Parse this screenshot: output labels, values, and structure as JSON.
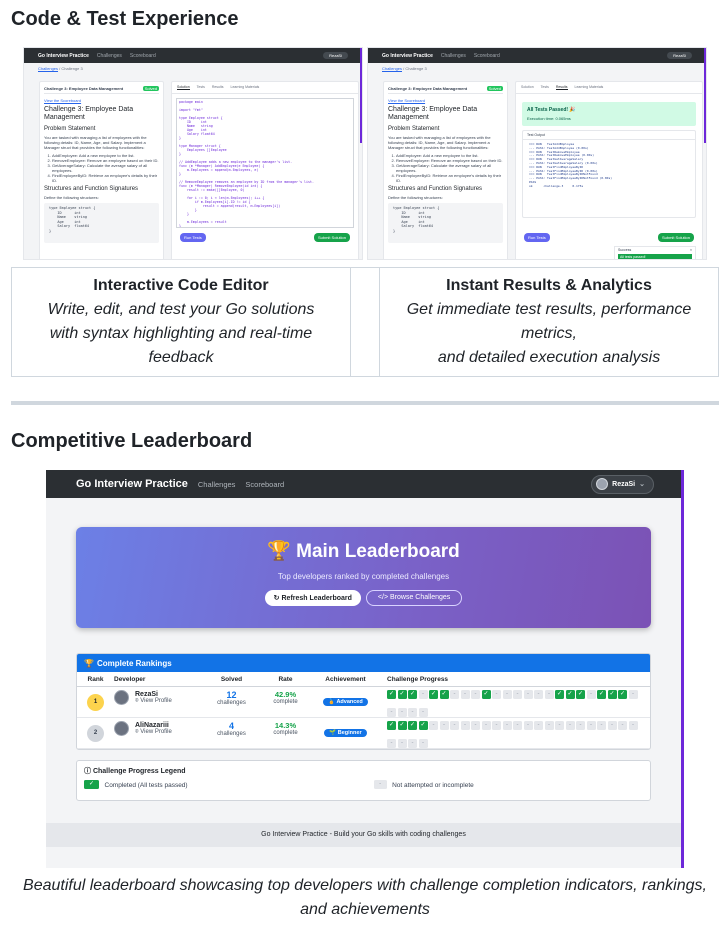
{
  "sections": {
    "code_test": "Code & Test Experience",
    "leaderboard": "Competitive Leaderboard"
  },
  "mini_app": {
    "brand": "Go Interview Practice",
    "nav_challenges": "Challenges",
    "nav_scoreboard": "Scoreboard",
    "user": "RezaSi",
    "crumb_link": "Challenges",
    "crumb_rest": " / Challenge 3",
    "panel_header": "Challenge 3: Employee Data Management",
    "panel_badge": "Solved",
    "view_scoreboard": "View the Scoreboard",
    "challenge_title": "Challenge 3: Employee Data Management",
    "problem_statement": "Problem Statement",
    "intro": "You are tasked with managing a list of employees with the following details: ID, Name, Age, and Salary. Implement a Manager struct that provides the following functionalities:",
    "funcs": [
      "AddEmployee: Add a new employee to the list.",
      "RemoveEmployee: Remove an employee based on their ID.",
      "GetAverageSalary: Calculate the average salary of all employees.",
      "FindEmployeeByID: Retrieve an employee's details by their ID."
    ],
    "structures": "Structures and Function Signatures",
    "define": "Define the following structures:",
    "code_snippet": "type Employee struct {\n    ID      int\n    Name    string\n    Age     int\n    Salary  float64\n}",
    "tabs": [
      "Solution",
      "Tests",
      "Results",
      "Learning Materials"
    ],
    "editor_code": "package main\n\nimport \"fmt\"\n\ntype Employee struct {\n    ID     int\n    Name   string\n    Age    int\n    Salary float64\n}\n\ntype Manager struct {\n    Employees []Employee\n}\n\n// AddEmployee adds a new employee to the manager's list.\nfunc (m *Manager) AddEmployee(e Employee) {\n    m.Employees = append(m.Employees, e)\n}\n\n// RemoveEmployee removes an employee by ID from the manager's list.\nfunc (m *Manager) RemoveEmployee(id int) {\n    result := make([]Employee, 0)\n\n    for i := 0; i < len(m.Employees); i++ {\n        if m.Employees[i].ID != id {\n            result = append(result, m.Employees[i])\n        }\n    }\n\n    m.Employees = result\n}",
    "run_tests": "Run Tests",
    "submit": "Submit Solution",
    "passed_title": "All Tests Passed! 🎉",
    "exec_time": "Execution time: 0.065ms",
    "test_output": "Test Output",
    "output_lines": "=== RUN   TestAddEmployee\n--- PASS: TestAddEmployee (0.00s)\n=== RUN   TestRemoveEmployee\n--- PASS: TestRemoveEmployee (0.00s)\n=== RUN   TestGetAverageSalary\n--- PASS: TestGetAverageSalary (0.00s)\n=== RUN   TestFindEmployeeByID\n--- PASS: TestFindEmployeeByID (0.00s)\n=== RUN   TestFindEmployeeByIDNotFound\n--- PASS: TestFindEmployeeByIDNotFound (0.00s)\nPASS\nok      challenge-3     0.175s",
    "toast_title": "Success",
    "toast_close": "×",
    "toast_body": "All tests passed!"
  },
  "features": [
    {
      "title": "Interactive Code Editor",
      "desc": "Write, edit, and test your Go solutions with syntax highlighting and real-time feedback"
    },
    {
      "title": "Instant Results & Analytics",
      "desc_line1": "Get immediate test results, performance metrics,",
      "desc_line2": "and detailed execution analysis"
    }
  ],
  "leaderboard_app": {
    "brand": "Go Interview Practice",
    "nav_challenges": "Challenges",
    "nav_scoreboard": "Scoreboard",
    "user": "RezaSi",
    "user_chevron": "⌄",
    "hero_title": "🏆 Main Leaderboard",
    "hero_sub": "Top developers ranked by completed challenges",
    "refresh_icon": "↻",
    "refresh": "Refresh Leaderboard",
    "browse_icon": "</>",
    "browse": "Browse Challenges",
    "rankings_icon": "🏆",
    "rankings_title": "Complete Rankings",
    "columns": [
      "Rank",
      "Developer",
      "Solved",
      "Rate",
      "Achievement",
      "Challenge Progress"
    ],
    "rows": [
      {
        "rank": "1",
        "name": "RezaSi",
        "view_profile": "View Profile",
        "solved": "12",
        "solved_unit": "challenges",
        "rate": "42.9%",
        "rate_unit": "complete",
        "achievement": "🏅 Advanced",
        "progress": [
          1,
          1,
          1,
          0,
          1,
          1,
          0,
          0,
          0,
          1,
          0,
          0,
          0,
          0,
          0,
          0,
          1,
          1,
          1,
          0,
          1,
          1,
          1,
          0,
          0,
          0,
          0,
          0
        ]
      },
      {
        "rank": "2",
        "name": "AliNazariii",
        "view_profile": "View Profile",
        "solved": "4",
        "solved_unit": "challenges",
        "rate": "14.3%",
        "rate_unit": "complete",
        "achievement": "🌱 Beginner",
        "progress": [
          1,
          1,
          1,
          1,
          0,
          0,
          0,
          0,
          0,
          0,
          0,
          0,
          0,
          0,
          0,
          0,
          0,
          0,
          0,
          0,
          0,
          0,
          0,
          0,
          0,
          0,
          0,
          0
        ]
      }
    ],
    "done_glyph": "✓",
    "todo_glyph": "-",
    "legend_icon": "ⓘ",
    "legend_title": "Challenge Progress Legend",
    "legend_done": "Completed (All tests passed)",
    "legend_todo": "Not attempted or incomplete",
    "footer": "Go Interview Practice - Build your Go skills with coding challenges"
  },
  "caption": "Beautiful leaderboard showcasing top developers with challenge completion indicators, rankings, and achievements",
  "colors": {
    "accent_blue": "#1273e6",
    "success_green": "#16a34a",
    "purple": "#6d28d9"
  }
}
